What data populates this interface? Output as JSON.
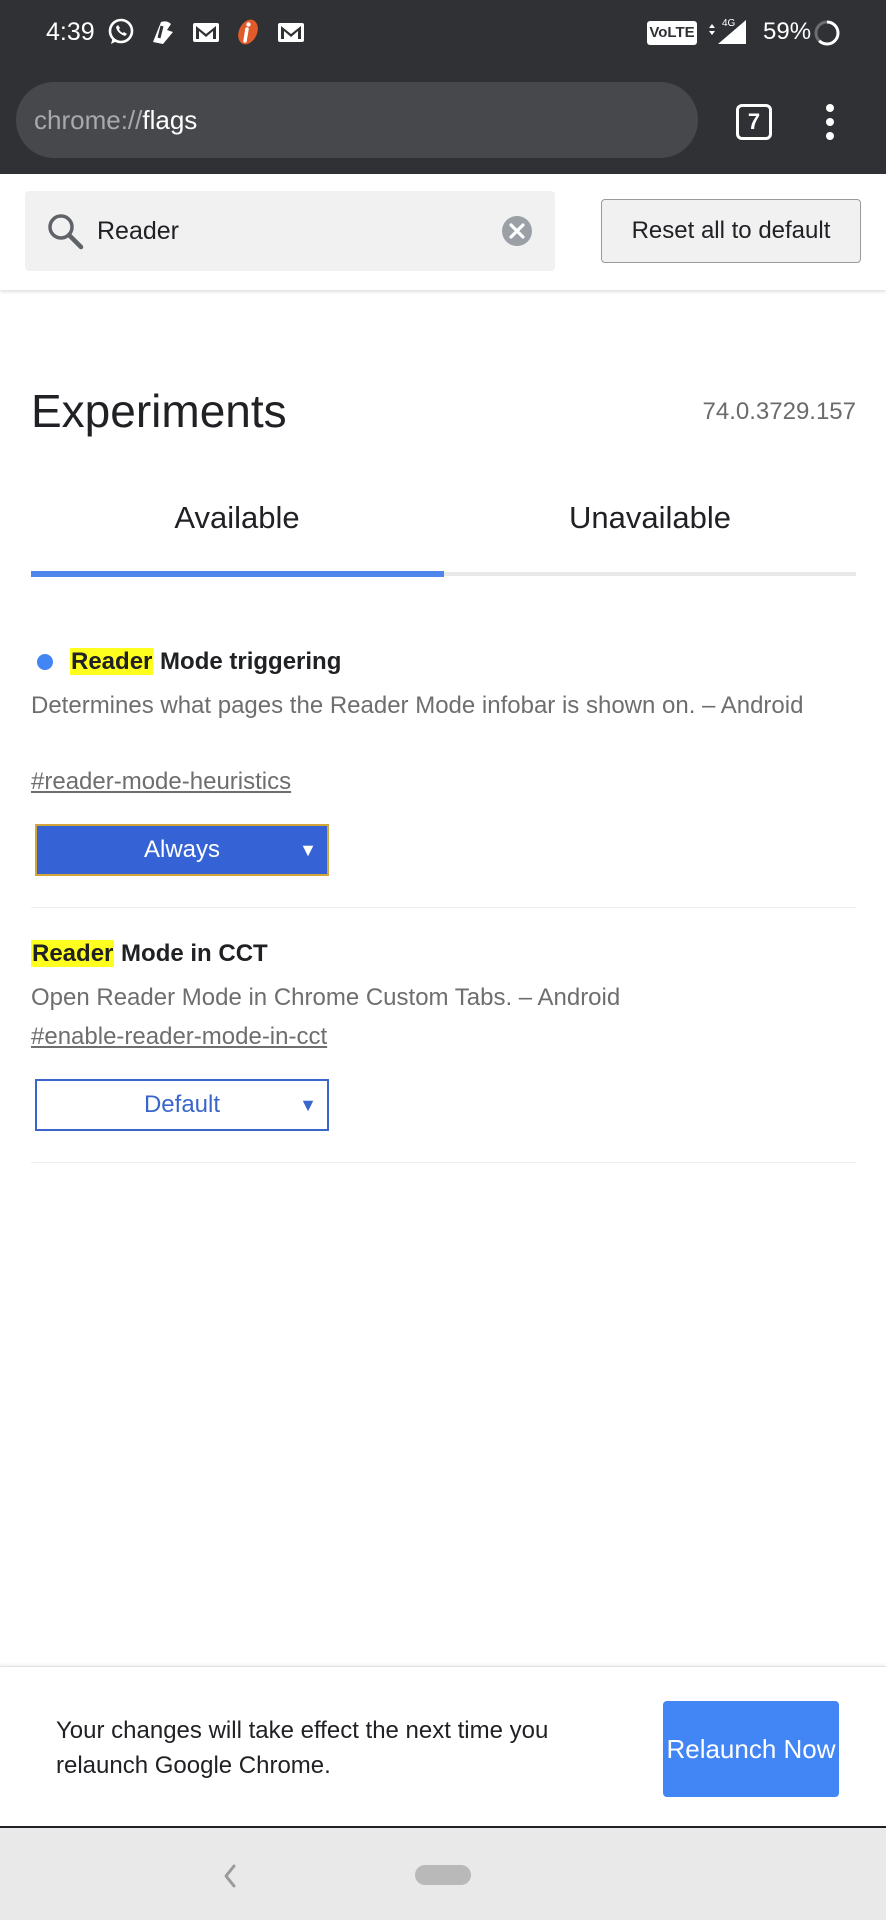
{
  "status_bar": {
    "time": "4:39",
    "notification_icons": [
      "whatsapp-icon",
      "app-icon",
      "gmail-icon",
      "icici-icon",
      "gmail-icon"
    ],
    "volte_label": "VoLTE",
    "network_type": "4G",
    "battery_percent": "59%"
  },
  "toolbar": {
    "url_scheme": "chrome://",
    "url_host": "flags",
    "tab_count": "7"
  },
  "search": {
    "value": "Reader",
    "reset_label": "Reset all to default"
  },
  "header": {
    "title": "Experiments",
    "version": "74.0.3729.157"
  },
  "tabs": [
    {
      "label": "Available",
      "selected": true
    },
    {
      "label": "Unavailable",
      "selected": false
    }
  ],
  "experiments": [
    {
      "highlight": "Reader",
      "name_rest": " Mode triggering",
      "description": "Determines what pages the Reader Mode infobar is shown on. – Android",
      "link": "#reader-mode-heuristics",
      "selected_option": "Always",
      "changed": true
    },
    {
      "highlight": "Reader",
      "name_rest": " Mode in CCT",
      "description": "Open Reader Mode in Chrome Custom Tabs. – Android",
      "link": "#enable-reader-mode-in-cct",
      "selected_option": "Default",
      "changed": false
    }
  ],
  "relaunch": {
    "message": "Your changes will take effect the next time you relaunch Google Chrome.",
    "button_label": "Relaunch Now"
  },
  "colors": {
    "accent": "#4285f4",
    "highlight": "#ffff1f",
    "toolbar": "#2f3134"
  }
}
